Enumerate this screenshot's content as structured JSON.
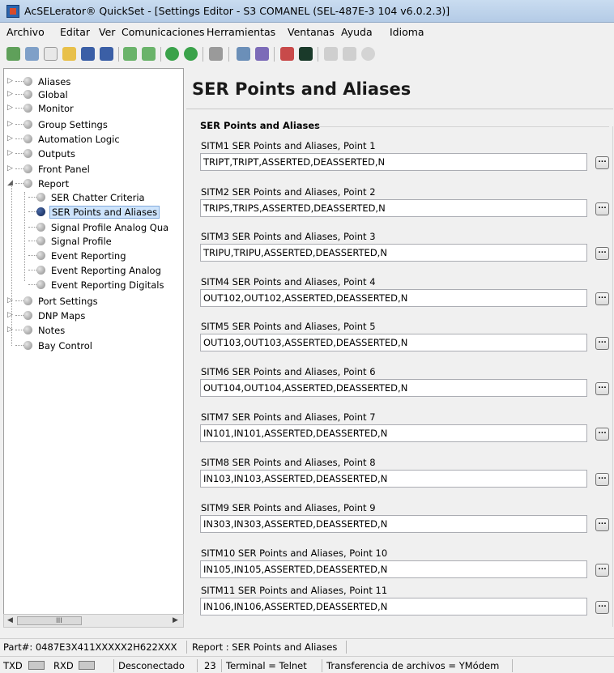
{
  "window": {
    "title": "AcSELerator® QuickSet - [Settings Editor - S3 COMANEL (SEL-487E-3 104 v6.0.2.3)]"
  },
  "menu": [
    "Archivo",
    "Editar",
    "Ver",
    "Comunicaciones",
    "Herramientas",
    "Ventanas",
    "Ayuda",
    "Idioma"
  ],
  "toolbar": {
    "icons": [
      "home-icon",
      "connect-icon",
      "new-icon",
      "open-icon",
      "save-icon",
      "save-all-icon",
      "import-icon",
      "export-icon",
      "go-icon",
      "upload-icon",
      "settings-icon",
      "read-icon",
      "send-icon",
      "hmi-icon",
      "terminal-icon",
      "report-icon",
      "list-icon",
      "gear-icon"
    ]
  },
  "tree": {
    "items": [
      {
        "label": "Aliases",
        "expander": "▷"
      },
      {
        "label": "Global",
        "expander": "▷"
      },
      {
        "label": "Monitor",
        "expander": "▷"
      },
      {
        "label": "Group Settings",
        "expander": "▷"
      },
      {
        "label": "Automation Logic",
        "expander": "▷"
      },
      {
        "label": "Outputs",
        "expander": "▷"
      },
      {
        "label": "Front Panel",
        "expander": "▷"
      },
      {
        "label": "Report",
        "expander": "◢"
      },
      {
        "label": "SER Chatter Criteria"
      },
      {
        "label": "SER Points and Aliases",
        "selected": true
      },
      {
        "label": "Signal Profile Analog Qua"
      },
      {
        "label": "Signal Profile"
      },
      {
        "label": "Event Reporting"
      },
      {
        "label": "Event Reporting Analog"
      },
      {
        "label": "Event Reporting Digitals"
      },
      {
        "label": "Port Settings",
        "expander": "▷"
      },
      {
        "label": "DNP Maps",
        "expander": "▷"
      },
      {
        "label": "Notes",
        "expander": "▷"
      },
      {
        "label": "Bay Control"
      }
    ],
    "scroll_grip": "III"
  },
  "panel": {
    "title": "SER Points and Aliases",
    "group_title": "SER Points and Aliases",
    "button_label": "...",
    "settings": [
      {
        "label": "SITM1  SER Points and Aliases, Point 1",
        "value": "TRIPT,TRIPT,ASSERTED,DEASSERTED,N"
      },
      {
        "label": "SITM2  SER Points and Aliases, Point 2",
        "value": "TRIPS,TRIPS,ASSERTED,DEASSERTED,N"
      },
      {
        "label": "SITM3  SER Points and Aliases, Point 3",
        "value": "TRIPU,TRIPU,ASSERTED,DEASSERTED,N"
      },
      {
        "label": "SITM4  SER Points and Aliases, Point 4",
        "value": "OUT102,OUT102,ASSERTED,DEASSERTED,N"
      },
      {
        "label": "SITM5  SER Points and Aliases, Point 5",
        "value": "OUT103,OUT103,ASSERTED,DEASSERTED,N"
      },
      {
        "label": "SITM6  SER Points and Aliases, Point 6",
        "value": "OUT104,OUT104,ASSERTED,DEASSERTED,N"
      },
      {
        "label": "SITM7  SER Points and Aliases, Point 7",
        "value": "IN101,IN101,ASSERTED,DEASSERTED,N"
      },
      {
        "label": "SITM8  SER Points and Aliases, Point 8",
        "value": "IN103,IN103,ASSERTED,DEASSERTED,N"
      },
      {
        "label": "SITM9  SER Points and Aliases, Point 9",
        "value": "IN303,IN303,ASSERTED,DEASSERTED,N"
      },
      {
        "label": "SITM10  SER Points and Aliases, Point 10",
        "value": "IN105,IN105,ASSERTED,DEASSERTED,N"
      },
      {
        "label": "SITM11  SER Points and Aliases, Point 11",
        "value": "IN106,IN106,ASSERTED,DEASSERTED,N"
      }
    ]
  },
  "status": {
    "part": "Part#: 0487E3X411XXXXX2H622XXX",
    "location": "Report : SER Points and Aliases",
    "txd": "TXD",
    "rxd": "RXD",
    "connection": "Desconectado",
    "number": "23",
    "terminal": "Terminal = Telnet",
    "transfer": "Transferencia de archivos = YMódem"
  }
}
